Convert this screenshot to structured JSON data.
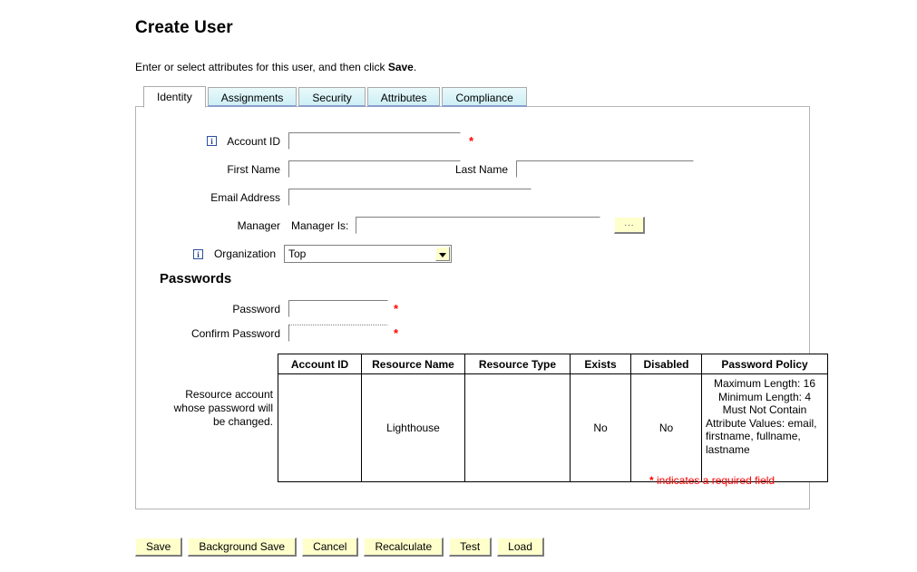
{
  "page": {
    "title": "Create User",
    "instruction_prefix": "Enter or select attributes for this user, and then click ",
    "instruction_bold": "Save",
    "instruction_suffix": "."
  },
  "tabs": [
    {
      "label": "Identity",
      "active": true
    },
    {
      "label": "Assignments",
      "active": false
    },
    {
      "label": "Security",
      "active": false
    },
    {
      "label": "Attributes",
      "active": false
    },
    {
      "label": "Compliance",
      "active": false
    }
  ],
  "form": {
    "account_id": {
      "label": "Account ID",
      "value": "",
      "required": true,
      "has_info_icon": true,
      "icon": "info-icon"
    },
    "first_name": {
      "label": "First Name",
      "value": "",
      "required": false
    },
    "last_name": {
      "label": "Last Name",
      "value": "",
      "required": false
    },
    "email_address": {
      "label": "Email Address",
      "value": "",
      "required": false
    },
    "manager": {
      "label": "Manager",
      "sublabel": "Manager Is:",
      "value": "",
      "browse_label": "...",
      "browse_icon": "ellipsis-icon"
    },
    "organization": {
      "label": "Organization",
      "selected": "Top",
      "options": [
        "Top"
      ],
      "has_info_icon": true,
      "icon": "info-icon",
      "arrow_icon": "chevron-down-icon"
    }
  },
  "passwords": {
    "heading": "Passwords",
    "password": {
      "label": "Password",
      "value": "",
      "required": true
    },
    "confirm_password": {
      "label": "Confirm Password",
      "value": "",
      "required": true
    }
  },
  "resource_section": {
    "label_lines": [
      "Resource account",
      "whose password will",
      "be changed."
    ],
    "columns": [
      "Account ID",
      "Resource Name",
      "Resource Type",
      "Exists",
      "Disabled",
      "Password Policy"
    ],
    "rows": [
      {
        "account_id": "",
        "resource_name": "Lighthouse",
        "resource_type": "",
        "exists": "No",
        "disabled": "No",
        "password_policy_lines": [
          "Maximum Length: 16",
          "Minimum Length: 4",
          "Must Not Contain",
          "Attribute Values: email,",
          "firstname, fullname,",
          "lastname"
        ]
      }
    ]
  },
  "required_note": {
    "star": "*",
    "text": " indicates a required field"
  },
  "buttons": [
    {
      "label": "Save"
    },
    {
      "label": "Background Save"
    },
    {
      "label": "Cancel"
    },
    {
      "label": "Recalculate"
    },
    {
      "label": "Test"
    },
    {
      "label": "Load"
    }
  ],
  "colors": {
    "required_red": "#ff0000",
    "tab_inactive_bg": "#d4f2f7",
    "tab_underline": "#8a9fd0",
    "button_bg": "#ffffcc",
    "panel_border": "#b4b4b4",
    "info_icon_blue": "#1a3a8f"
  },
  "asterisk": "*"
}
